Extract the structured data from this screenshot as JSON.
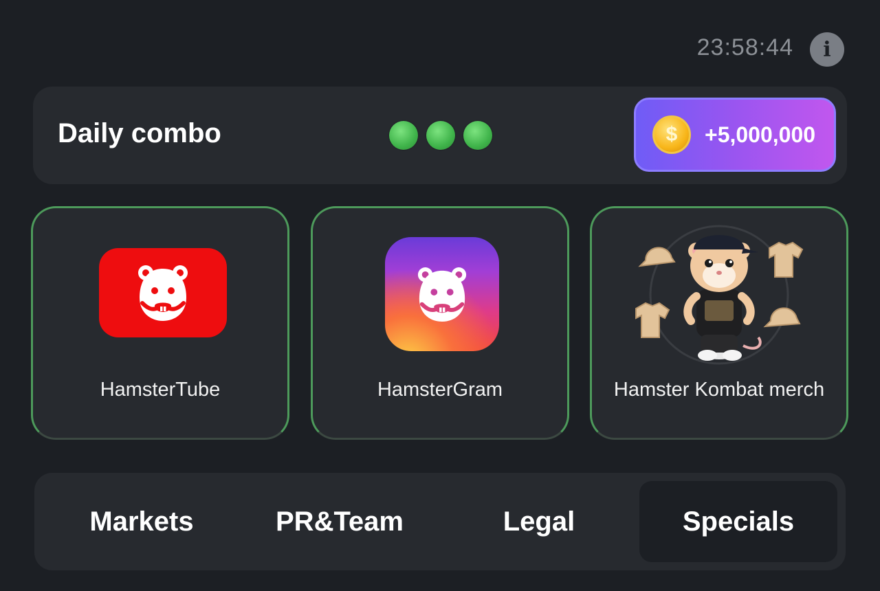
{
  "timer": "23:58:44",
  "daily_combo": {
    "title": "Daily combo",
    "found_dots": 3,
    "reward": "+5,000,000",
    "coin_symbol": "$"
  },
  "cards": [
    {
      "label": "HamsterTube",
      "icon": "hamstertube-logo"
    },
    {
      "label": "HamsterGram",
      "icon": "hamstergram-logo"
    },
    {
      "label": "Hamster Kombat merch",
      "icon": "hamster-merch-image"
    }
  ],
  "tabs": [
    {
      "label": "Markets"
    },
    {
      "label": "PR&Team"
    },
    {
      "label": "Legal"
    },
    {
      "label": "Specials",
      "active": true
    }
  ],
  "colors": {
    "background": "#1c1f24",
    "panel": "#272a2f",
    "card_border": "#4d9a5b",
    "dot_green": "#4cc253",
    "pill_start": "#6f5cf6",
    "pill_end": "#c157ee",
    "tube_red": "#ee0d0f"
  }
}
